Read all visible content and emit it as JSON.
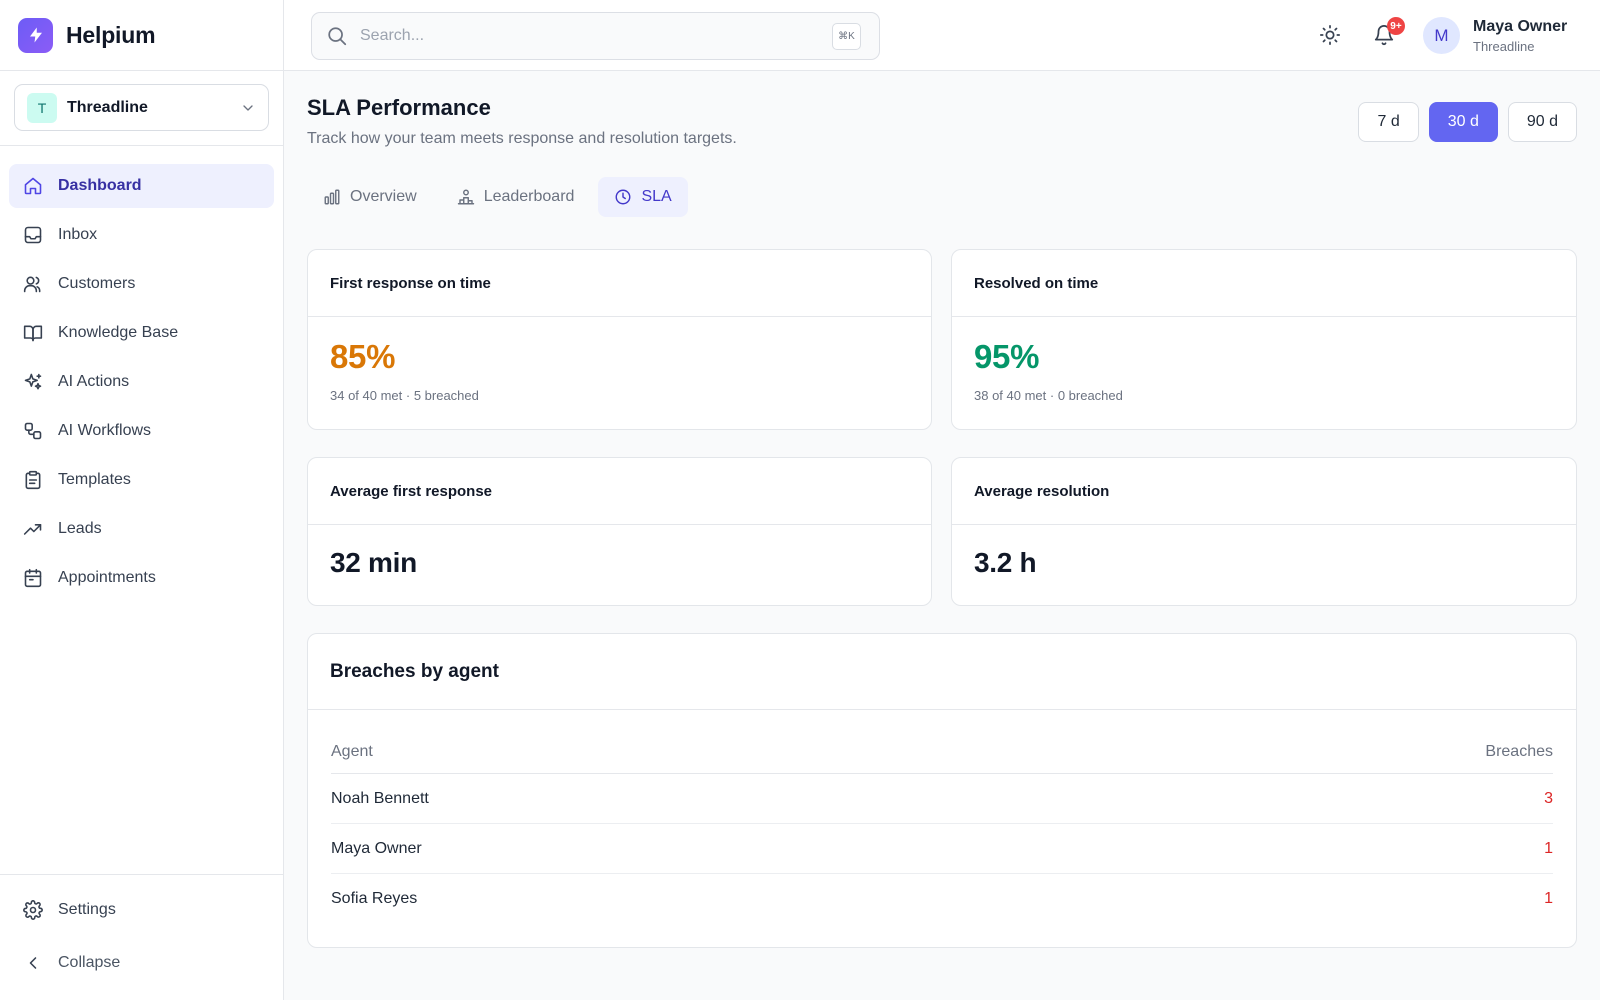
{
  "brand": {
    "name": "Helpium"
  },
  "workspace": {
    "initial": "T",
    "name": "Threadline"
  },
  "sidebar": {
    "items": [
      {
        "label": "Dashboard",
        "icon": "home-icon",
        "active": true
      },
      {
        "label": "Inbox",
        "icon": "inbox-icon"
      },
      {
        "label": "Customers",
        "icon": "users-icon"
      },
      {
        "label": "Knowledge Base",
        "icon": "book-icon"
      },
      {
        "label": "AI Actions",
        "icon": "sparkles-icon"
      },
      {
        "label": "AI Workflows",
        "icon": "workflow-icon"
      },
      {
        "label": "Templates",
        "icon": "clipboard-icon"
      },
      {
        "label": "Leads",
        "icon": "trending-up-icon"
      },
      {
        "label": "Appointments",
        "icon": "calendar-icon"
      }
    ],
    "settings_label": "Settings",
    "collapse_label": "Collapse"
  },
  "search": {
    "placeholder": "Search...",
    "shortcut": "⌘K"
  },
  "notifications": {
    "badge": "9+"
  },
  "user": {
    "initial": "M",
    "name": "Maya Owner",
    "org": "Threadline"
  },
  "page": {
    "title": "SLA Performance",
    "subtitle": "Track how your team meets response and resolution targets."
  },
  "ranges": [
    {
      "label": "7 d",
      "active": false
    },
    {
      "label": "30 d",
      "active": true
    },
    {
      "label": "90 d",
      "active": false
    }
  ],
  "tabs": [
    {
      "label": "Overview",
      "icon": "bar-chart-icon",
      "active": false
    },
    {
      "label": "Leaderboard",
      "icon": "podium-icon",
      "active": false
    },
    {
      "label": "SLA",
      "icon": "clock-icon",
      "active": true
    }
  ],
  "cards": {
    "first_response": {
      "title": "First response on time",
      "value": "85%",
      "note": "34 of 40 met · 5 breached",
      "color": "#d97706"
    },
    "resolved": {
      "title": "Resolved on time",
      "value": "95%",
      "note": "38 of 40 met · 0 breached",
      "color": "#059669"
    },
    "avg_first_response": {
      "title": "Average first response",
      "value": "32 min"
    },
    "avg_resolution": {
      "title": "Average resolution",
      "value": "3.2 h"
    }
  },
  "breaches": {
    "title": "Breaches by agent",
    "columns": {
      "agent": "Agent",
      "breaches": "Breaches"
    },
    "rows": [
      {
        "agent": "Noah Bennett",
        "breaches": "3"
      },
      {
        "agent": "Maya Owner",
        "breaches": "1"
      },
      {
        "agent": "Sofia Reyes",
        "breaches": "1"
      }
    ]
  },
  "colors": {
    "accent": "#6366f1",
    "danger": "#dc2626",
    "warning": "#d97706",
    "success": "#059669"
  }
}
